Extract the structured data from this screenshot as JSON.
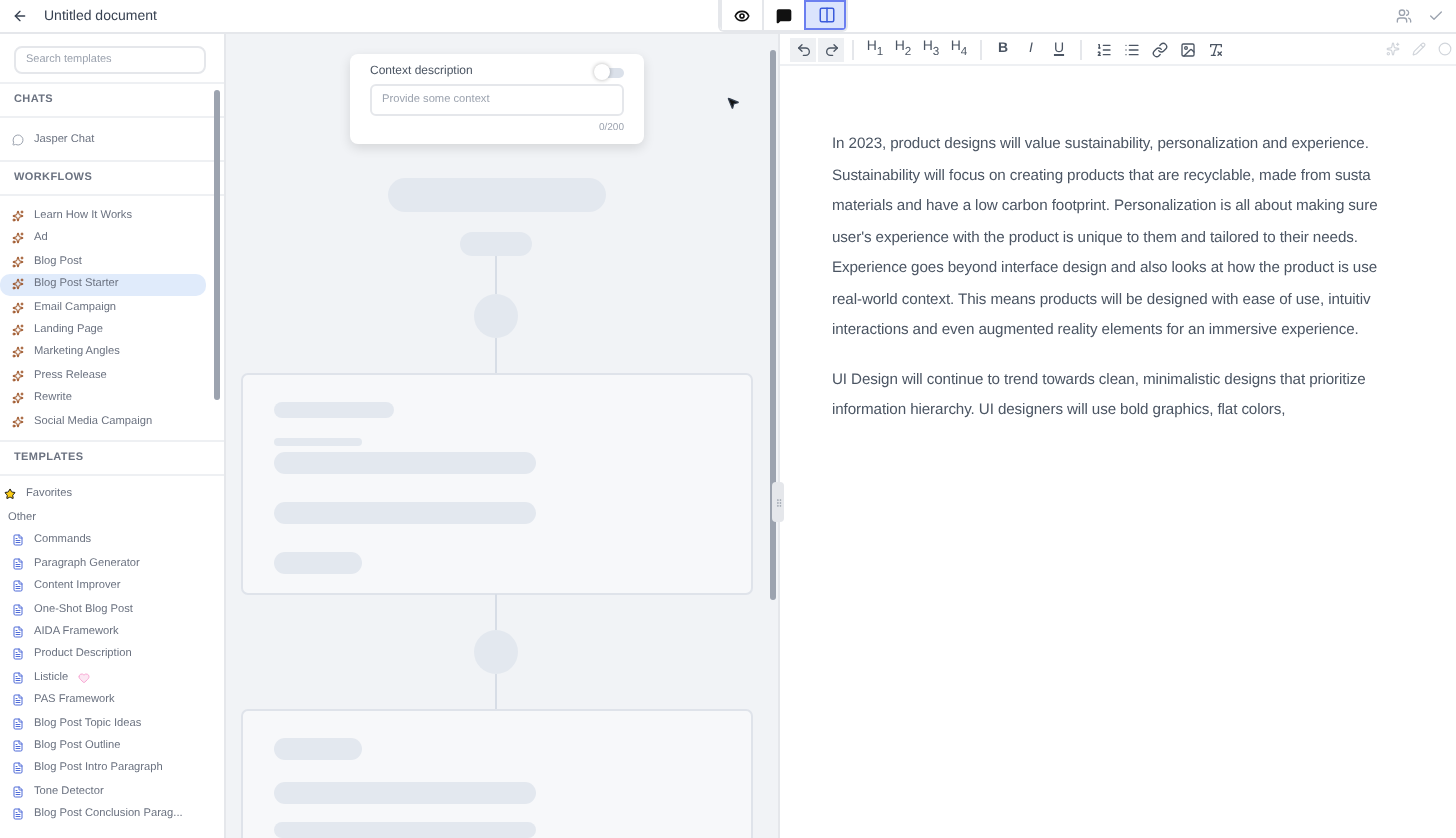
{
  "header": {
    "title": "Untitled document",
    "view_modes": [
      {
        "kind": "preview",
        "selected": false
      },
      {
        "kind": "chat",
        "selected": false
      },
      {
        "kind": "split",
        "selected": true
      }
    ]
  },
  "sidebar": {
    "search": {
      "placeholder": "Search templates"
    },
    "chats": {
      "heading": "CHATS",
      "items": [
        {
          "label": "Jasper Chat",
          "selected": false
        }
      ]
    },
    "workflows": {
      "heading": "WORKFLOWS",
      "items": [
        {
          "label": "Learn How It Works",
          "selected": false
        },
        {
          "label": "Ad",
          "selected": false
        },
        {
          "label": "Blog Post",
          "selected": false
        },
        {
          "label": "Blog Post Starter",
          "selected": true
        },
        {
          "label": "Email Campaign",
          "selected": false
        },
        {
          "label": "Landing Page",
          "selected": false
        },
        {
          "label": "Marketing Angles",
          "selected": false
        },
        {
          "label": "Press Release",
          "selected": false
        },
        {
          "label": "Rewrite",
          "selected": false
        },
        {
          "label": "Social Media Campaign",
          "selected": false
        }
      ]
    },
    "templates": {
      "heading": "TEMPLATES",
      "favorites": "Favorites",
      "group": "Other",
      "items": [
        {
          "label": "Commands",
          "selected": false,
          "flagged": false
        },
        {
          "label": "Paragraph Generator",
          "selected": false,
          "flagged": false
        },
        {
          "label": "Content Improver",
          "selected": false,
          "flagged": false
        },
        {
          "label": "One-Shot Blog Post",
          "selected": false,
          "flagged": false
        },
        {
          "label": "AIDA Framework",
          "selected": false,
          "flagged": false
        },
        {
          "label": "Product Description",
          "selected": false,
          "flagged": false
        },
        {
          "label": "Listicle",
          "selected": false,
          "flagged": true
        },
        {
          "label": "PAS Framework",
          "selected": false,
          "flagged": false
        },
        {
          "label": "Blog Post Topic Ideas",
          "selected": false,
          "flagged": false
        },
        {
          "label": "Blog Post Outline",
          "selected": false,
          "flagged": false
        },
        {
          "label": "Blog Post Intro Paragraph",
          "selected": false,
          "flagged": false
        },
        {
          "label": "Tone Detector",
          "selected": false,
          "flagged": false
        },
        {
          "label": "Blog Post Conclusion Parag...",
          "selected": false,
          "flagged": false
        }
      ]
    }
  },
  "context_card": {
    "label": "Context description",
    "toggle_on": false,
    "placeholder": "Provide some context",
    "counter": "0/200"
  },
  "toolbar": [
    {
      "kind": "undo"
    },
    {
      "kind": "redo"
    },
    {
      "kind": "heading",
      "label": "H$_{1}$"
    },
    {
      "kind": "heading",
      "label": "H$_{2}$"
    },
    {
      "kind": "heading",
      "label": "H$_{3}$"
    },
    {
      "kind": "heading",
      "label": "H$_{4}$"
    },
    {
      "kind": "bold",
      "label": "B"
    },
    {
      "kind": "italic",
      "label": "I"
    },
    {
      "kind": "underline",
      "label": "U"
    },
    {
      "kind": "ordered-list"
    },
    {
      "kind": "bullet-list"
    },
    {
      "kind": "link"
    },
    {
      "kind": "image"
    },
    {
      "kind": "clear-format"
    }
  ],
  "editor": {
    "paragraphs": [
      [
        "In 2023, product designs will value sustainability, personalization and experience.",
        "Sustainability will focus on creating products that are recyclable, made from susta",
        "materials and have a low carbon footprint. Personalization is all about making sure",
        "user's experience with the product is unique to them and tailored to their needs.",
        "Experience goes beyond interface design and also looks at how the product is use",
        "real-world context. This means products will be designed with ease of use, intuitiv",
        "interactions and even augmented reality elements for an immersive experience."
      ],
      [
        "UI Design will continue to trend towards clean, minimalistic designs that prioritize",
        "information hierarchy. UI designers will use bold graphics, flat colors,"
      ]
    ]
  }
}
